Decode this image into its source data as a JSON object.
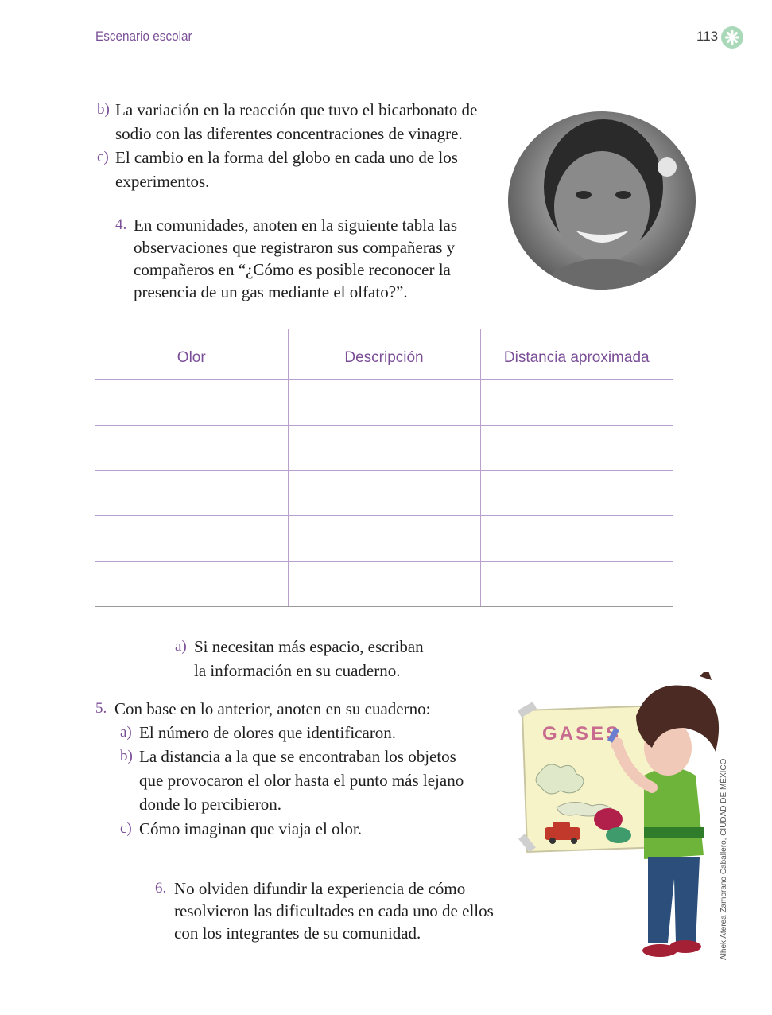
{
  "header": {
    "section": "Escenario escolar",
    "page_number": "113",
    "icon": "gear-icon"
  },
  "list_b": {
    "marker": "b)",
    "lines": [
      "La variación en la reacción que tuvo el bicarbonato de",
      "sodio con las diferentes concentraciones de vinagre."
    ]
  },
  "list_c": {
    "marker": "c)",
    "lines": [
      "El cambio en la forma del globo en cada uno de los",
      "experimentos."
    ]
  },
  "item4": {
    "marker": "4.",
    "lines": [
      "En comunidades, anoten en la siguiente tabla las",
      "observaciones que registraron sus compañeras y",
      "compañeros en “¿Cómo es posible reconocer la",
      "presencia de un gas mediante el olfato?”."
    ]
  },
  "table": {
    "headers": [
      "Olor",
      "Descripción",
      "Distancia aproximada"
    ],
    "rows": [
      [
        "",
        "",
        ""
      ],
      [
        "",
        "",
        ""
      ],
      [
        "",
        "",
        ""
      ],
      [
        "",
        "",
        ""
      ],
      [
        "",
        "",
        ""
      ]
    ]
  },
  "item4a": {
    "marker": "a)",
    "lines": [
      "Si necesitan más espacio, escriban",
      "la información en su cuaderno."
    ]
  },
  "item5": {
    "marker": "5.",
    "intro": "Con base en lo anterior, anoten en su cuaderno:",
    "a": {
      "marker": "a)",
      "lines": [
        "El número de olores que identificaron."
      ]
    },
    "b": {
      "marker": "b)",
      "lines": [
        "La distancia a la que se encontraban los objetos",
        "que provocaron el olor hasta el punto más lejano",
        "donde lo percibieron."
      ]
    },
    "c": {
      "marker": "c)",
      "lines": [
        "Cómo imaginan que viaja el olor."
      ]
    }
  },
  "item6": {
    "marker": "6.",
    "lines": [
      "No olviden difundir la experiencia de cómo",
      "resolvieron las dificultades en cada uno de ellos",
      "con los integrantes de su comunidad."
    ]
  },
  "illustration": {
    "poster_text": "GASES",
    "credit": "Alhek Aterea Zamorano Caballero, CIUDAD DE MÉXICO"
  }
}
